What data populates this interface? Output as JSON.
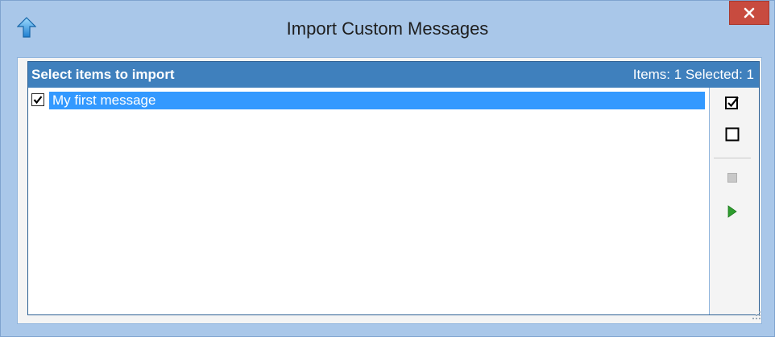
{
  "window": {
    "title": "Import Custom Messages",
    "icon": "up-arrow-icon",
    "close_icon": "close-icon"
  },
  "panel": {
    "caption": "Select items to import",
    "counts": "Items: 1  Selected: 1"
  },
  "items": [
    {
      "label": "My first message",
      "checked": true,
      "selected": true
    }
  ],
  "toolbar": {
    "buttons": [
      {
        "name": "check-all",
        "icon": "checked-box-icon"
      },
      {
        "name": "uncheck-all",
        "icon": "empty-box-icon"
      },
      {
        "name": "stop",
        "icon": "stop-icon",
        "enabled": false
      },
      {
        "name": "run",
        "icon": "play-icon",
        "enabled": true
      }
    ]
  },
  "colors": {
    "window_frame": "#a9c7e9",
    "header": "#3f80bd",
    "selection": "#3399ff",
    "close": "#c84b3f",
    "play": "#2e9d2e"
  }
}
